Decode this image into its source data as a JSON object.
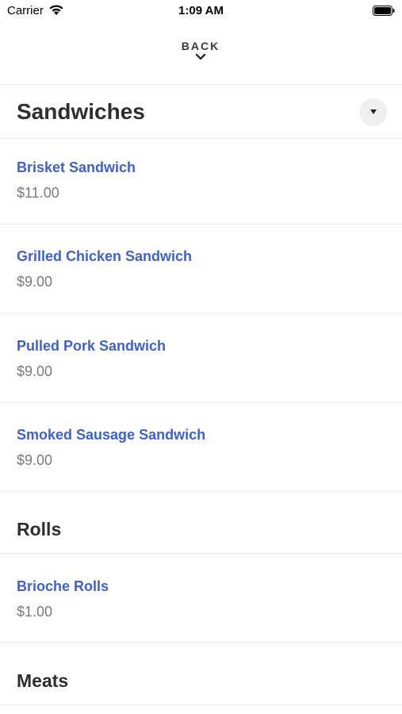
{
  "status_bar": {
    "carrier": "Carrier",
    "time": "1:09 AM"
  },
  "nav": {
    "back_label": "BACK"
  },
  "sections": [
    {
      "title": "Sandwiches",
      "items": [
        {
          "name": "Brisket Sandwich",
          "price": "$11.00"
        },
        {
          "name": "Grilled Chicken Sandwich",
          "price": "$9.00"
        },
        {
          "name": "Pulled Pork Sandwich",
          "price": "$9.00"
        },
        {
          "name": "Smoked Sausage Sandwich",
          "price": "$9.00"
        }
      ]
    },
    {
      "title": "Rolls",
      "items": [
        {
          "name": "Brioche Rolls",
          "price": "$1.00"
        }
      ]
    },
    {
      "title": "Meats",
      "items": []
    }
  ],
  "colors": {
    "item_name": "#3f5fcf",
    "price": "#7a7a7a",
    "divider": "#ececec"
  }
}
